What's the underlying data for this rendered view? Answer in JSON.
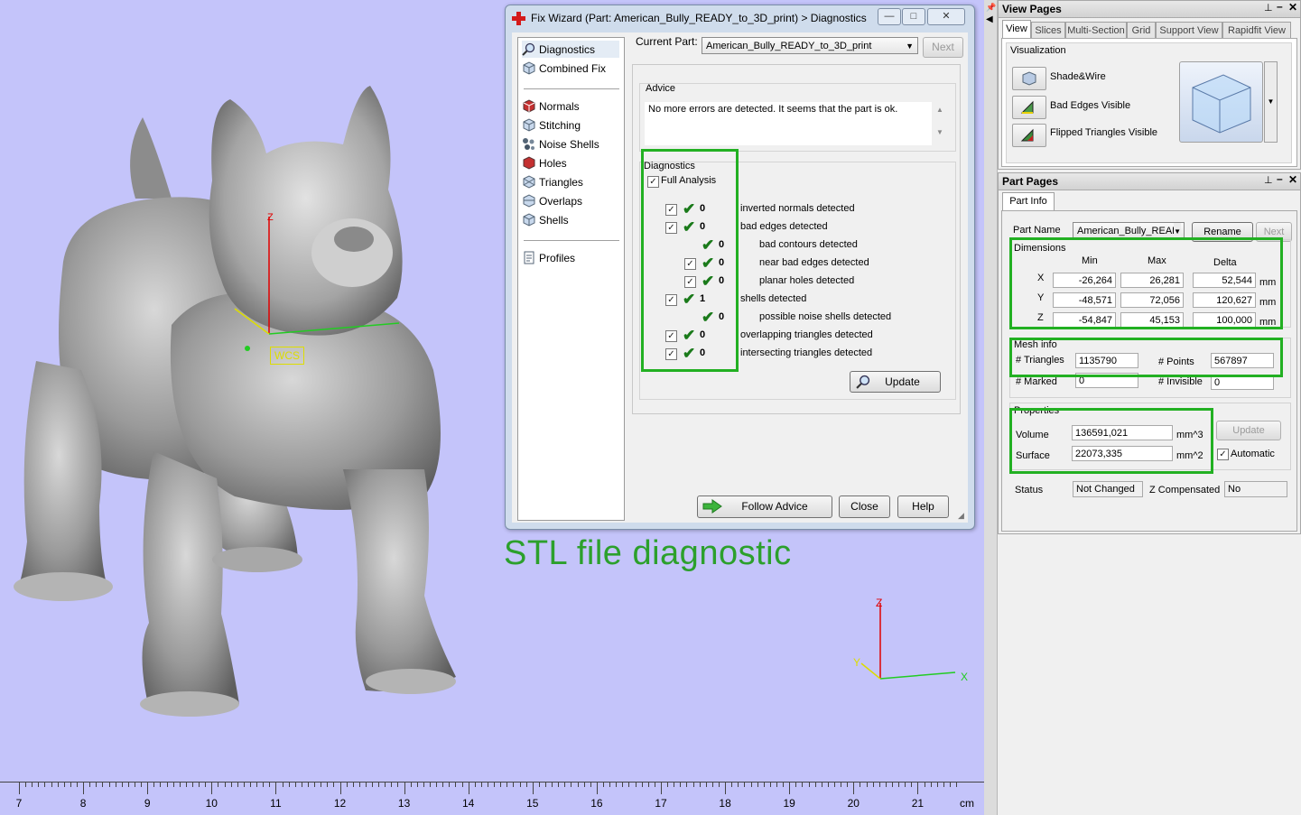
{
  "viewport": {
    "ruler_labels": [
      "7",
      "8",
      "9",
      "10",
      "11",
      "12",
      "13",
      "14",
      "15",
      "16",
      "17",
      "18",
      "19",
      "20",
      "21"
    ],
    "ruler_unit": "cm",
    "overlay_title": "STL file diagnostic",
    "overlay_color": "#2ca02c",
    "wcs_label": "WCS",
    "axes": {
      "z": "Z",
      "y": "Y",
      "x": "X"
    }
  },
  "fix_wizard": {
    "title": "Fix Wizard (Part: American_Bully_READY_to_3D_print) > Diagnostics",
    "window_buttons": [
      "—",
      "□",
      "✕"
    ],
    "nav": {
      "group1": [
        {
          "label": "Diagnostics",
          "icon": "magnifier-icon",
          "selected": true
        },
        {
          "label": "Combined Fix",
          "icon": "cube-icon"
        }
      ],
      "group2": [
        {
          "label": "Normals",
          "icon": "normals-icon"
        },
        {
          "label": "Stitching",
          "icon": "stitching-icon"
        },
        {
          "label": "Noise Shells",
          "icon": "noise-shells-icon"
        },
        {
          "label": "Holes",
          "icon": "holes-icon"
        },
        {
          "label": "Triangles",
          "icon": "triangles-icon"
        },
        {
          "label": "Overlaps",
          "icon": "overlaps-icon"
        },
        {
          "label": "Shells",
          "icon": "shells-icon"
        }
      ],
      "group3": [
        {
          "label": "Profiles",
          "icon": "profiles-icon"
        }
      ]
    },
    "current_part_label": "Current Part:",
    "current_part_value": "American_Bully_READY_to_3D_print",
    "next_button": "Next",
    "advice_label": "Advice",
    "advice_text": "No more errors are detected. It seems that the part is ok.",
    "diagnostics_label": "Diagnostics",
    "full_analysis_label": "Full Analysis",
    "rows": [
      {
        "count": "0",
        "label": "inverted normals detected",
        "indent": false,
        "checkbox": true
      },
      {
        "count": "0",
        "label": "bad edges detected",
        "indent": false,
        "checkbox": true
      },
      {
        "count": "0",
        "label": "bad contours detected",
        "indent": true,
        "checkbox": false
      },
      {
        "count": "0",
        "label": "near bad edges detected",
        "indent": true,
        "checkbox": true
      },
      {
        "count": "0",
        "label": "planar holes detected",
        "indent": true,
        "checkbox": true
      },
      {
        "count": "1",
        "label": "shells detected",
        "indent": false,
        "checkbox": true
      },
      {
        "count": "0",
        "label": "possible noise shells detected",
        "indent": true,
        "checkbox": false
      },
      {
        "count": "0",
        "label": "overlapping triangles detected",
        "indent": false,
        "checkbox": true
      },
      {
        "count": "0",
        "label": "intersecting triangles detected",
        "indent": false,
        "checkbox": true
      }
    ],
    "update_button": "Update",
    "follow_advice_button": "Follow Advice",
    "close_button": "Close",
    "help_button": "Help"
  },
  "view_pages": {
    "title": "View Pages",
    "tabs": [
      "View",
      "Slices",
      "Multi-Section",
      "Grid",
      "Support View",
      "Rapidfit View"
    ],
    "visualization_label": "Visualization",
    "buttons": [
      "Shade&Wire",
      "Bad Edges Visible",
      "Flipped Triangles Visible"
    ]
  },
  "part_pages": {
    "title": "Part Pages",
    "tab": "Part Info",
    "part_name_label": "Part Name",
    "part_name_value": "American_Bully_READ",
    "rename_button": "Rename",
    "next_button": "Next",
    "dimensions": {
      "label": "Dimensions",
      "headers": [
        "Min",
        "Max",
        "Delta"
      ],
      "rows": [
        {
          "axis": "X",
          "min": "-26,264",
          "max": "26,281",
          "delta": "52,544",
          "unit": "mm"
        },
        {
          "axis": "Y",
          "min": "-48,571",
          "max": "72,056",
          "delta": "120,627",
          "unit": "mm"
        },
        {
          "axis": "Z",
          "min": "-54,847",
          "max": "45,153",
          "delta": "100,000",
          "unit": "mm"
        }
      ]
    },
    "mesh_info": {
      "label": "Mesh info",
      "triangles_label": "# Triangles",
      "triangles": "1135790",
      "points_label": "# Points",
      "points": "567897",
      "marked_label": "# Marked",
      "marked": "0",
      "invisible_label": "# Invisible",
      "invisible": "0"
    },
    "properties": {
      "label": "Properties",
      "volume_label": "Volume",
      "volume": "136591,021",
      "volume_unit": "mm^3",
      "surface_label": "Surface",
      "surface": "22073,335",
      "surface_unit": "mm^2",
      "update_button": "Update",
      "automatic_label": "Automatic"
    },
    "status_label": "Status",
    "status_value": "Not Changed",
    "zcomp_label": "Z Compensated",
    "zcomp_value": "No"
  }
}
